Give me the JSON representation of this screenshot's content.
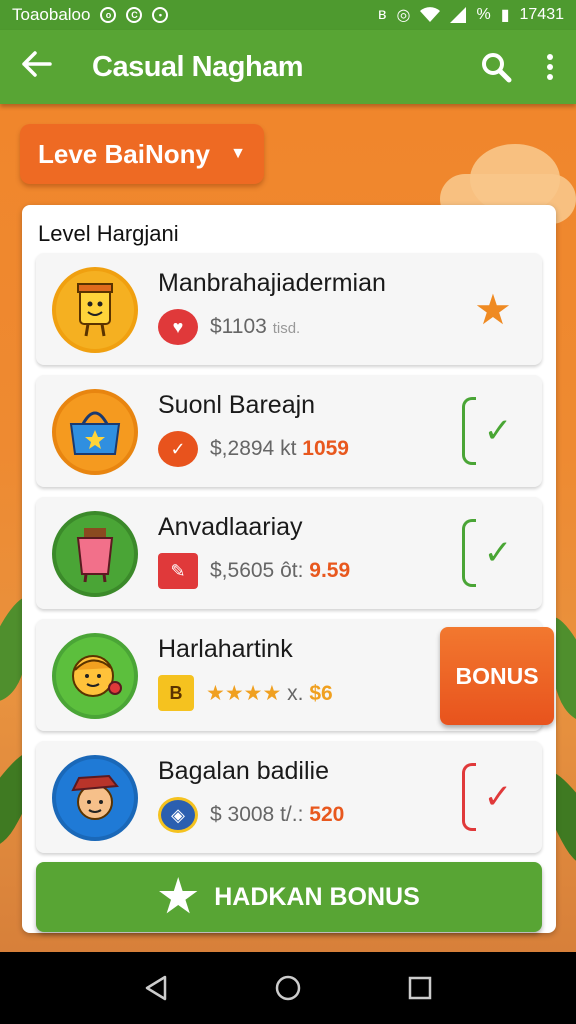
{
  "status_bar": {
    "carrier": "Toaobaloo",
    "time": "17431",
    "battery_label": "%"
  },
  "app_bar": {
    "back_icon": "arrow-left-icon",
    "title": "Casual Nagham",
    "search_icon": "search-icon",
    "more_icon": "more-vert-icon"
  },
  "dropdown": {
    "label": "Leve BaiNony",
    "caret_icon": "caret-down-icon"
  },
  "card": {
    "title": "Level Hargjani",
    "rows": [
      {
        "name": "Manbrahajiadermian",
        "price": "$1103",
        "extra": "tisd.",
        "highlight": "",
        "action": "star",
        "avatar_color": "#f5b021",
        "avatar_icon": "cup-character-icon",
        "meta_icon": "heart-badge-icon",
        "meta_color": "#e0393a"
      },
      {
        "name": "Suonl Bareajn",
        "price": "$,2894",
        "extra": "kt",
        "highlight": "1059",
        "action": "check",
        "avatar_color": "#f59a1f",
        "avatar_icon": "shopping-bag-icon",
        "meta_icon": "check-badge-icon",
        "meta_color": "#e8531d"
      },
      {
        "name": "Anvadlaariay",
        "price": "$,5605",
        "extra": "ôt:",
        "highlight": "9.59",
        "action": "check",
        "avatar_color": "#4aa536",
        "avatar_icon": "drink-cup-icon",
        "meta_icon": "ticket-icon",
        "meta_color": "#e0393a"
      },
      {
        "name": "Harlahartink",
        "price": "★★★★",
        "extra": "x.",
        "highlight": "$6",
        "action": "bonus",
        "bonus_label": "BONUS",
        "avatar_color": "#5cbf3d",
        "avatar_icon": "character-face-icon",
        "meta_icon": "b-badge-icon",
        "meta_label": "B",
        "meta_color": "#f5c21f"
      },
      {
        "name": "Bagalan badilie",
        "price": "$ 3008",
        "extra": "t/.:",
        "highlight": "520",
        "action": "check-red",
        "avatar_color": "#1f7ad6",
        "avatar_icon": "hat-character-icon",
        "meta_icon": "coin-badge-icon",
        "meta_color": "#2b5fb0"
      }
    ]
  },
  "claim_button": {
    "label": "HADKAN BONUS",
    "icon": "star-burst-icon"
  },
  "nav_bar": {
    "back": "nav-back-icon",
    "home": "nav-home-icon",
    "recents": "nav-recents-icon"
  }
}
